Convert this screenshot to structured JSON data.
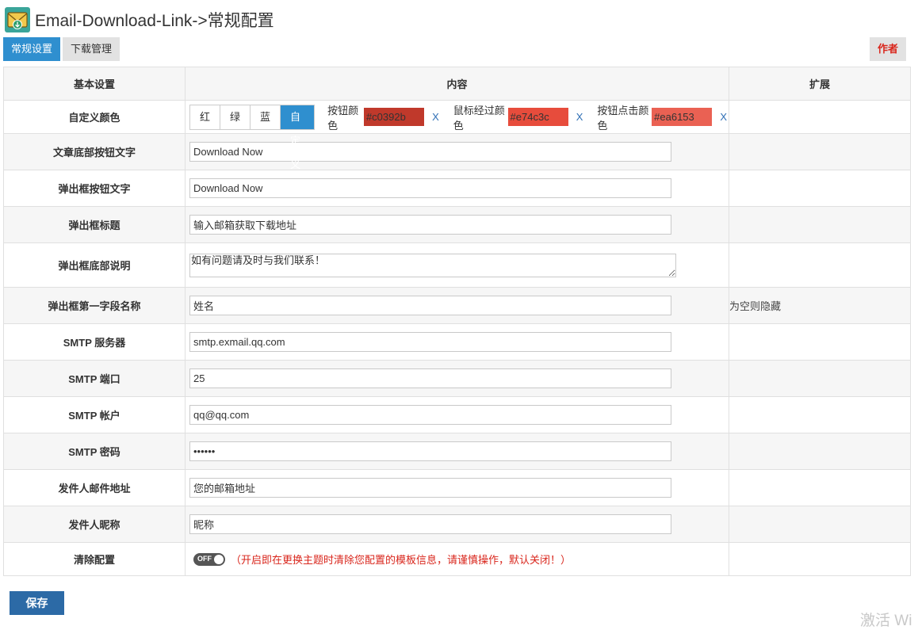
{
  "app": {
    "title": "Email-Download-Link->常规配置"
  },
  "tabs": [
    {
      "label": "常规设置"
    },
    {
      "label": "下载管理"
    }
  ],
  "author_button": "作者",
  "table": {
    "headers": {
      "basic": "基本设置",
      "content": "内容",
      "extend": "扩展"
    },
    "color_row": {
      "label": "自定义颜色",
      "options": [
        "红",
        "绿",
        "蓝",
        "自定义"
      ],
      "selected": "自定义",
      "button_color_label": "按钮颜色",
      "button_color": "#c0392b",
      "hover_color_label": "鼠标经过颜色",
      "hover_color": "#e74c3c",
      "click_color_label": "按钮点击颜色",
      "click_color": "#ea6153",
      "clear": "X"
    },
    "rows": [
      {
        "label": "文章底部按钮文字",
        "value": "Download Now",
        "ext": ""
      },
      {
        "label": "弹出框按钮文字",
        "value": "Download Now",
        "ext": ""
      },
      {
        "label": "弹出框标题",
        "value": "输入邮箱获取下载地址",
        "ext": ""
      },
      {
        "label": "弹出框底部说明",
        "value": "如有问题请及时与我们联系！",
        "ext": ""
      },
      {
        "label": "弹出框第一字段名称",
        "value": "姓名",
        "ext": "为空则隐藏"
      },
      {
        "label": "SMTP 服务器",
        "value": "smtp.exmail.qq.com",
        "ext": ""
      },
      {
        "label": "SMTP 端口",
        "value": "25",
        "ext": ""
      },
      {
        "label": "SMTP 帐户",
        "value": "qq@qq.com",
        "ext": ""
      },
      {
        "label": "SMTP 密码",
        "value": "••••••",
        "ext": ""
      },
      {
        "label": "发件人邮件地址",
        "value": "您的邮箱地址",
        "ext": ""
      },
      {
        "label": "发件人昵称",
        "value": "昵称",
        "ext": ""
      }
    ],
    "clear_row": {
      "label": "清除配置",
      "toggle": "OFF",
      "note": "（开启即在更换主题时清除您配置的模板信息，请谨慎操作，默认关闭！）"
    }
  },
  "save_button": "保存",
  "watermark": "激活 Wi",
  "colors": {
    "accent": "#2f8fcf",
    "save": "#2c6aa6",
    "warn": "#d9261c"
  }
}
